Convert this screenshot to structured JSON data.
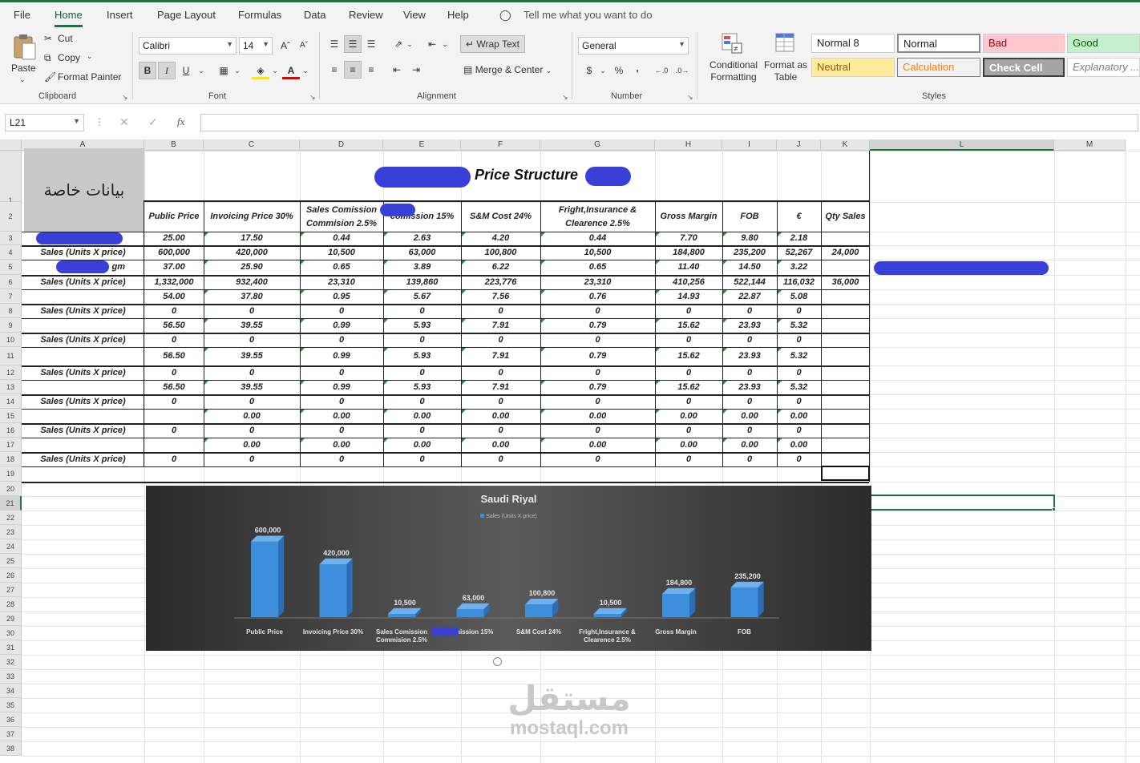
{
  "tabs": [
    "File",
    "Home",
    "Insert",
    "Page Layout",
    "Formulas",
    "Data",
    "Review",
    "View",
    "Help"
  ],
  "tell_me": "Tell me what you want to do",
  "clipboard": {
    "paste": "Paste",
    "cut": "Cut",
    "copy": "Copy",
    "format_painter": "Format Painter",
    "label": "Clipboard"
  },
  "font": {
    "name": "Calibri",
    "size": "14",
    "label": "Font",
    "bold": "B",
    "italic": "I",
    "underline": "U"
  },
  "alignment": {
    "wrap_text": "Wrap Text",
    "merge_center": "Merge & Center",
    "label": "Alignment"
  },
  "number": {
    "format": "General",
    "currency": "$",
    "percent": "%",
    "comma": ",",
    "label": "Number"
  },
  "styles": {
    "conditional_formatting": "Conditional Formatting",
    "format_as_table": "Format as Table",
    "cells": [
      "Normal 8",
      "Normal",
      "Bad",
      "Good",
      "Neutral",
      "Calculation",
      "Check Cell",
      "Explanatory ..."
    ],
    "label": "Styles"
  },
  "formula_bar": {
    "name_box": "L21",
    "fx": "fx"
  },
  "columns": [
    "A",
    "B",
    "C",
    "D",
    "E",
    "F",
    "G",
    "H",
    "I",
    "J",
    "K",
    "L",
    "M"
  ],
  "rows": [
    "1",
    "2",
    "3",
    "4",
    "5",
    "6",
    "7",
    "8",
    "9",
    "10",
    "11",
    "12",
    "13",
    "14",
    "15",
    "16",
    "17",
    "18",
    "19",
    "20",
    "21",
    "22",
    "23",
    "24",
    "25",
    "26",
    "27",
    "28",
    "29",
    "30",
    "31",
    "32",
    "33",
    "34",
    "35",
    "36",
    "37",
    "38"
  ],
  "sheet": {
    "arabic_label": "بيانات خاصة",
    "title": "Price Structure",
    "headers": [
      "Public Price",
      "Invoicing Price 30%",
      "Sales Comission Commision 2.5%",
      "comission 15%",
      "S&M Cost 24%",
      "Fright,Insurance & Clearence 2.5%",
      "Gross Margin",
      "FOB",
      "€",
      "Qty Sales"
    ],
    "row_labels": [
      "",
      "Sales (Units X price)",
      "gm",
      "Sales (Units X price)",
      "",
      "Sales (Units X price)",
      "",
      "Sales (Units X price)",
      "",
      "Sales (Units X price)",
      "",
      "Sales (Units X price)",
      "",
      "Sales (Units X price)",
      "",
      "Sales (Units X price)"
    ],
    "data": [
      [
        "25.00",
        "17.50",
        "0.44",
        "2.63",
        "4.20",
        "0.44",
        "7.70",
        "9.80",
        "2.18",
        ""
      ],
      [
        "600,000",
        "420,000",
        "10,500",
        "63,000",
        "100,800",
        "10,500",
        "184,800",
        "235,200",
        "52,267",
        "24,000"
      ],
      [
        "37.00",
        "25.90",
        "0.65",
        "3.89",
        "6.22",
        "0.65",
        "11.40",
        "14.50",
        "3.22",
        ""
      ],
      [
        "1,332,000",
        "932,400",
        "23,310",
        "139,860",
        "223,776",
        "23,310",
        "410,256",
        "522,144",
        "116,032",
        "36,000"
      ],
      [
        "54.00",
        "37.80",
        "0.95",
        "5.67",
        "7.56",
        "0.76",
        "14.93",
        "22.87",
        "5.08",
        ""
      ],
      [
        "0",
        "0",
        "0",
        "0",
        "0",
        "0",
        "0",
        "0",
        "0",
        ""
      ],
      [
        "56.50",
        "39.55",
        "0.99",
        "5.93",
        "7.91",
        "0.79",
        "15.62",
        "23.93",
        "5.32",
        ""
      ],
      [
        "0",
        "0",
        "0",
        "0",
        "0",
        "0",
        "0",
        "0",
        "0",
        ""
      ],
      [
        "56.50",
        "39.55",
        "0.99",
        "5.93",
        "7.91",
        "0.79",
        "15.62",
        "23.93",
        "5.32",
        ""
      ],
      [
        "0",
        "0",
        "0",
        "0",
        "0",
        "0",
        "0",
        "0",
        "0",
        ""
      ],
      [
        "56.50",
        "39.55",
        "0.99",
        "5.93",
        "7.91",
        "0.79",
        "15.62",
        "23.93",
        "5.32",
        ""
      ],
      [
        "0",
        "0",
        "0",
        "0",
        "0",
        "0",
        "0",
        "0",
        "0",
        ""
      ],
      [
        "",
        "0.00",
        "0.00",
        "0.00",
        "0.00",
        "0.00",
        "0.00",
        "0.00",
        "0.00",
        ""
      ],
      [
        "0",
        "0",
        "0",
        "0",
        "0",
        "0",
        "0",
        "0",
        "0",
        ""
      ],
      [
        "",
        "0.00",
        "0.00",
        "0.00",
        "0.00",
        "0.00",
        "0.00",
        "0.00",
        "0.00",
        ""
      ],
      [
        "0",
        "0",
        "0",
        "0",
        "0",
        "0",
        "0",
        "0",
        "0",
        ""
      ]
    ]
  },
  "chart_data": {
    "type": "bar",
    "title": "Saudi Riyal",
    "legend": "Sales (Units X price)",
    "legend_position": "top",
    "categories": [
      "Public Price",
      "Invoicing Price 30%",
      "Sales Comission Commision 2.5%",
      "comission 15%",
      "S&M Cost 24%",
      "Fright,Insurance & Clearence 2.5%",
      "Gross Margin",
      "FOB"
    ],
    "series": [
      {
        "name": "Sales (Units X price)",
        "values": [
          600000,
          420000,
          10500,
          63000,
          100800,
          10500,
          184800,
          235200
        ]
      }
    ],
    "data_labels": [
      "600,000",
      "420,000",
      "10,500",
      "63,000",
      "100,800",
      "10,500",
      "184,800",
      "235,200"
    ],
    "ylim": [
      0,
      700000
    ],
    "grid": false,
    "bar_color": "#3d8fdc"
  },
  "watermark": {
    "arabic": "مستقل",
    "latin": "mostaql.com"
  }
}
